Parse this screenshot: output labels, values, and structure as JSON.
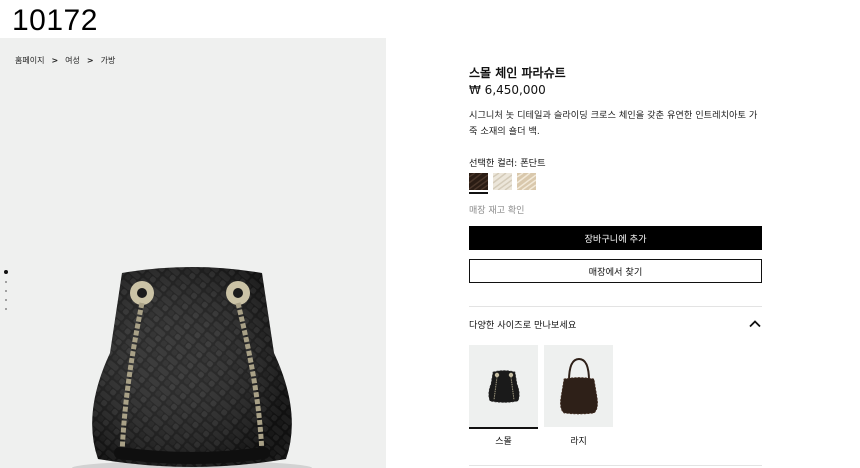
{
  "page_id": "10172",
  "breadcrumb": [
    "홈페이지",
    "여성",
    "가방"
  ],
  "product": {
    "title": "스몰 체인 파라슈트",
    "price": "₩ 6,450,000",
    "description": "시그니처 놋 디테일과 슬라이딩 크로스 체인을 갖춘 유연한 인트레치아토 가죽 소재의 숄더 백."
  },
  "color": {
    "label": "선택한 컬러: 폰단트",
    "swatches": [
      {
        "name": "fondant",
        "color": "#2a1c14",
        "selected": true
      },
      {
        "name": "chalk",
        "color": "#ece6da",
        "selected": false
      },
      {
        "name": "sand",
        "color": "#d9c8ac",
        "selected": false
      }
    ]
  },
  "store_check": "매장 재고 확인",
  "buttons": {
    "add_to_cart": "장바구니에 추가",
    "find_in_store": "매장에서 찾기"
  },
  "sizes": {
    "heading": "다양한 사이즈로 만나보세요",
    "options": [
      {
        "label": "스몰",
        "selected": true
      },
      {
        "label": "라지",
        "selected": false
      }
    ]
  },
  "gallery": {
    "image_count": 6,
    "active_index": 0
  },
  "colors": {
    "gallery_bg": "#eff0ef",
    "primary_button": "#000000",
    "bag_leather": "#141414",
    "hardware": "#b8ad8e"
  }
}
